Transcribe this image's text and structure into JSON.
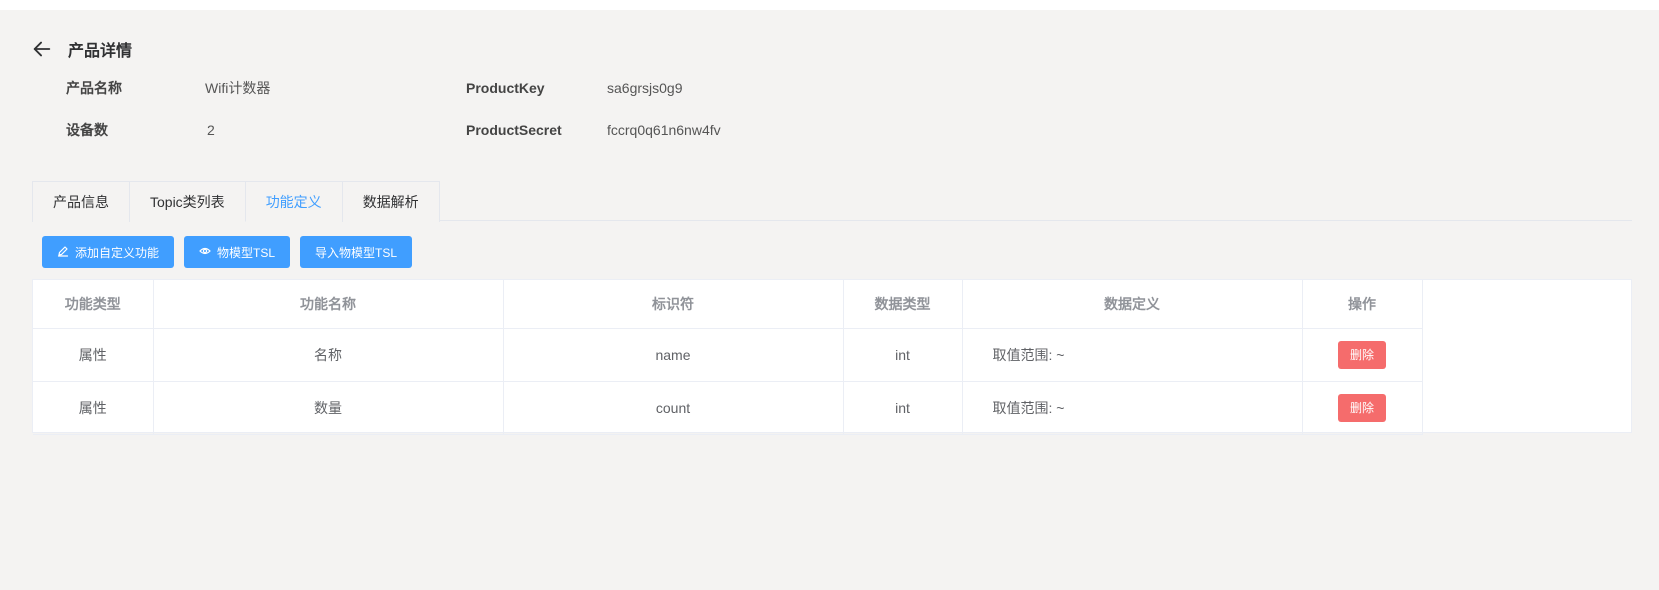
{
  "header": {
    "title": "产品详情",
    "back_icon": "arrow-left-icon"
  },
  "product": {
    "name_label": "产品名称",
    "name_value": "Wifi计数器",
    "device_count_label": "设备数",
    "device_count_value": "2",
    "key_label": "ProductKey",
    "key_value": "sa6grsjs0g9",
    "secret_label": "ProductSecret",
    "secret_value": "fccrq0q61n6nw4fv"
  },
  "tabs": [
    {
      "label": "产品信息",
      "active": false
    },
    {
      "label": "Topic类列表",
      "active": false
    },
    {
      "label": "功能定义",
      "active": true
    },
    {
      "label": "数据解析",
      "active": false
    }
  ],
  "toolbar": {
    "add_label": "添加自定义功能",
    "add_icon": "edit-icon",
    "tsl_label": "物模型TSL",
    "tsl_icon": "eye-icon",
    "import_label": "导入物模型TSL"
  },
  "table": {
    "columns": [
      "功能类型",
      "功能名称",
      "标识符",
      "数据类型",
      "数据定义",
      "操作"
    ],
    "rows": [
      {
        "type": "属性",
        "name": "名称",
        "identifier": "name",
        "data_type": "int",
        "definition": "取值范围: ~",
        "action": "删除"
      },
      {
        "type": "属性",
        "name": "数量",
        "identifier": "count",
        "data_type": "int",
        "definition": "取值范围: ~",
        "action": "删除"
      }
    ]
  },
  "colors": {
    "primary": "#409eff",
    "danger": "#f56c6c",
    "background": "#f4f3f2"
  }
}
